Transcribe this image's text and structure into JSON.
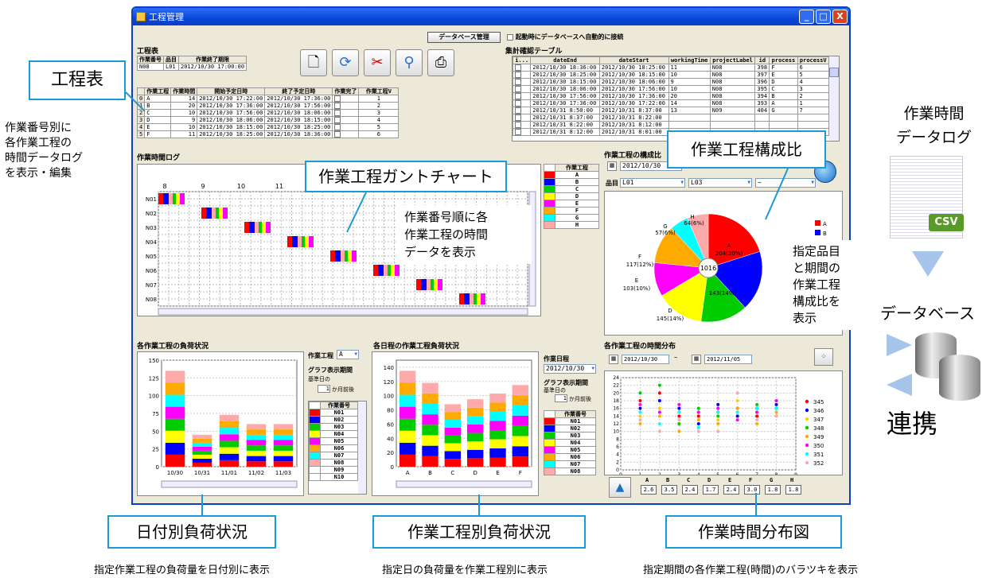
{
  "window": {
    "title": "工程管理",
    "controls": [
      "_",
      "□",
      "X"
    ]
  },
  "top": {
    "db_button": "データベース管理",
    "auto_connect": "起動時にデータベースへ自動的に接続"
  },
  "kouteihyo": {
    "title": "工程表",
    "headers": [
      "作業番号",
      "品目",
      "作業終了期限"
    ],
    "row": [
      "N08",
      "L01",
      "2012/10/30 17:00:00"
    ],
    "detail_headers": [
      "",
      "作業工程",
      "作業時間",
      "開始予定日時",
      "終了予定日時",
      "作業完了",
      "作業工程V"
    ],
    "detail_rows": [
      [
        "0",
        "A",
        "14",
        "2012/10/30 17:22:00",
        "2012/10/30 17:36:00",
        "",
        "1"
      ],
      [
        "1",
        "B",
        "20",
        "2012/10/30 17:36:00",
        "2012/10/30 17:56:00",
        "",
        "2"
      ],
      [
        "2",
        "C",
        "10",
        "2012/10/30 17:56:00",
        "2012/10/30 18:06:00",
        "",
        "3"
      ],
      [
        "3",
        "D",
        "9",
        "2012/10/30 18:06:00",
        "2012/10/30 18:15:00",
        "",
        "4"
      ],
      [
        "4",
        "E",
        "10",
        "2012/10/30 18:15:00",
        "2012/10/30 18:25:00",
        "",
        "5"
      ],
      [
        "5",
        "F",
        "11",
        "2012/10/30 18:25:00",
        "2012/10/30 18:36:00",
        "",
        "6"
      ]
    ]
  },
  "shukei": {
    "title": "集計確認テーブル",
    "headers": [
      "i...",
      "dateEnd",
      "dateStart",
      "workingTime",
      "projectLabel",
      "id",
      "process",
      "processV"
    ],
    "rows": [
      [
        "",
        "2012/10/30 18:36:00",
        "2012/10/30 18:25:00",
        "11",
        "N08",
        "398",
        "F",
        "6"
      ],
      [
        "",
        "2012/10/30 18:25:00",
        "2012/10/30 18:15:00",
        "10",
        "N08",
        "397",
        "E",
        "5"
      ],
      [
        "",
        "2012/10/30 18:15:00",
        "2012/10/30 18:06:00",
        "9",
        "N08",
        "396",
        "D",
        "4"
      ],
      [
        "",
        "2012/10/30 18:06:00",
        "2012/10/30 17:56:00",
        "10",
        "N08",
        "395",
        "C",
        "3"
      ],
      [
        "",
        "2012/10/30 17:56:00",
        "2012/10/30 17:36:00",
        "20",
        "N08",
        "394",
        "B",
        "2"
      ],
      [
        "",
        "2012/10/30 17:36:00",
        "2012/10/30 17:22:00",
        "14",
        "N08",
        "393",
        "A",
        "1"
      ],
      [
        "",
        "2012/10/31 8:50:00",
        "2012/10/31 8:37:00",
        "13",
        "N09",
        "404",
        "G",
        "7"
      ],
      [
        "",
        "2012/10/31 8:37:00",
        "2012/10/31 8:22:00",
        "",
        "",
        "",
        "",
        ""
      ],
      [
        "",
        "2012/10/31 8:22:00",
        "2012/10/31 8:12:00",
        "",
        "",
        "",
        "",
        ""
      ],
      [
        "",
        "2012/10/31 8:12:00",
        "2012/10/31 8:01:00",
        "",
        "",
        "",
        "",
        ""
      ]
    ]
  },
  "gantt": {
    "title": "作業時間ログ",
    "hours": [
      "8",
      "9",
      "10",
      "11",
      "12"
    ],
    "rows": [
      "N01",
      "N02",
      "N03",
      "N04",
      "N05",
      "N06",
      "N07",
      "N08"
    ],
    "legend_title": "作業工程",
    "legend": [
      "A",
      "B",
      "C",
      "D",
      "E",
      "F",
      "G",
      "H"
    ]
  },
  "ratio": {
    "title": "作業工程の構成比",
    "date_from": "2012/10/30",
    "hinmoku_label": "品目",
    "hinmoku_from": "L01",
    "hinmoku_to": "L03",
    "hinmoku_sep": "~",
    "total": "1016",
    "labels": [
      "A",
      "204(20%)",
      "",
      "143(14%)",
      "D",
      "145(14%)",
      "E",
      "103(10%)",
      "F",
      "117(12%)",
      "G",
      "57(6%)",
      "H",
      "64(6%)"
    ],
    "legend": [
      "A",
      "B"
    ]
  },
  "load_date": {
    "title": "各作業工程の負荷状況",
    "process_label": "作業工程",
    "process_value": "A",
    "period_label": "グラフ表示期間",
    "base_label": "基準日の",
    "months": "1",
    "months_suffix": "か月前後",
    "list_title": "作業番号",
    "list": [
      "N01",
      "N02",
      "N03",
      "N04",
      "N05",
      "N06",
      "N07",
      "N08",
      "N09",
      "N10"
    ]
  },
  "load_process": {
    "title": "各日程の作業工程負荷状況",
    "date_label": "作業日程",
    "date_value": "2012/10/30",
    "period_label": "グラフ表示期間",
    "base_label": "基準日の",
    "months": "1",
    "months_suffix": "か月前後",
    "list_title": "作業番号",
    "list": [
      "N01",
      "N02",
      "N03",
      "N04",
      "N05",
      "N06",
      "N07",
      "N08"
    ]
  },
  "dist": {
    "title": "各作業工程の時間分布",
    "date_from": "2012/10/30",
    "tilde": "~",
    "date_to": "2012/11/05",
    "legend": [
      "345",
      "346",
      "347",
      "348",
      "349",
      "350",
      "351",
      "352"
    ],
    "process_labels": [
      "A",
      "B",
      "C",
      "D",
      "E",
      "F",
      "G",
      "H"
    ],
    "process_values": [
      "2.6",
      "3.5",
      "2.4",
      "1.7",
      "2.4",
      "3.0",
      "1.8",
      "1.8"
    ]
  },
  "chart_data": [
    {
      "type": "bar",
      "title": "",
      "categories": [
        "10/30",
        "10/31",
        "11/01",
        "11/02",
        "11/03"
      ],
      "values": [
        135,
        45,
        73,
        60,
        60
      ],
      "ylim": [
        0,
        150
      ],
      "yticks": [
        0,
        25,
        50,
        75,
        100,
        125,
        150
      ]
    },
    {
      "type": "bar",
      "title": "",
      "categories": [
        "A",
        "B",
        "C",
        "D",
        "E",
        "F"
      ],
      "values": [
        135,
        118,
        88,
        95,
        103,
        115
      ],
      "ylim": [
        0,
        150
      ],
      "yticks": [
        0,
        20,
        40,
        60,
        80,
        100,
        120,
        140
      ]
    },
    {
      "type": "pie",
      "title": "",
      "total": 1016,
      "slices": [
        {
          "name": "A",
          "value": 204
        },
        {
          "name": "B",
          "value": 183
        },
        {
          "name": "C",
          "value": 143
        },
        {
          "name": "D",
          "value": 145
        },
        {
          "name": "E",
          "value": 103
        },
        {
          "name": "F",
          "value": 117
        },
        {
          "name": "G",
          "value": 57
        },
        {
          "name": "H",
          "value": 64
        }
      ]
    },
    {
      "type": "scatter",
      "title": "",
      "xlim": [
        0,
        9
      ],
      "ylim": [
        0,
        24
      ],
      "xticks": [
        0,
        1,
        2,
        3,
        4,
        5,
        6,
        7,
        8,
        9
      ],
      "yticks": [
        0,
        2,
        4,
        6,
        8,
        10,
        12,
        14,
        16,
        18,
        20,
        22,
        24
      ],
      "series": [
        {
          "name": "345",
          "x": [
            1,
            2,
            3,
            4,
            5,
            6,
            7,
            8
          ],
          "y": [
            18,
            20,
            14,
            14,
            15,
            16,
            14,
            16
          ]
        },
        {
          "name": "346",
          "x": [
            1,
            2,
            3,
            4,
            5,
            6,
            7,
            8
          ],
          "y": [
            16,
            18,
            16,
            12,
            17,
            14,
            16,
            17
          ]
        },
        {
          "name": "347",
          "x": [
            1,
            2,
            3,
            4,
            5,
            6,
            7,
            8
          ],
          "y": [
            14,
            16,
            12,
            15,
            13,
            18,
            15,
            14
          ]
        },
        {
          "name": "348",
          "x": [
            1,
            2,
            3,
            4,
            5,
            6,
            7,
            8
          ],
          "y": [
            20,
            22,
            12,
            16,
            14,
            15,
            17,
            18
          ]
        },
        {
          "name": "349",
          "x": [
            1,
            2,
            3,
            4,
            5,
            6,
            7,
            8
          ],
          "y": [
            12,
            14,
            10,
            13,
            12,
            16,
            12,
            15
          ]
        },
        {
          "name": "350",
          "x": [
            1,
            2,
            3,
            4,
            5,
            6,
            7,
            8
          ],
          "y": [
            17,
            15,
            17,
            15,
            16,
            13,
            15,
            18
          ]
        },
        {
          "name": "351",
          "x": [
            1,
            2,
            3,
            4,
            5,
            6,
            7,
            8
          ],
          "y": [
            15,
            12,
            15,
            11,
            15,
            15,
            16,
            16
          ]
        },
        {
          "name": "352",
          "x": [
            1,
            2,
            3,
            4,
            5,
            6,
            7,
            8
          ],
          "y": [
            13,
            10,
            13,
            10,
            10,
            20,
            13,
            14
          ]
        }
      ]
    }
  ],
  "colors": {
    "A": "#ff0000",
    "B": "#0000ff",
    "C": "#00cc00",
    "D": "#ffff00",
    "E": "#ff00ff",
    "F": "#ffaa00",
    "G": "#00ffff",
    "H": "#ffaaaa",
    "dark": "#800000",
    "olive": "#999900"
  },
  "annotations": {
    "koutei": "工程表",
    "koutei_note": [
      "作業番号別に",
      "各作業工程の",
      "時間データログ",
      "を表示・編集"
    ],
    "gantt": "作業工程ガントチャート",
    "gantt_note": [
      "作業番号順に各",
      "作業工程の時間",
      "データを表示"
    ],
    "ratio": "作業工程構成比",
    "ratio_note": [
      "指定品目",
      "と期間の",
      "作業工程",
      "構成比を",
      "表示"
    ],
    "date_load": "日付別負荷状況",
    "date_load_note": "指定作業工程の負荷量を日付別に表示",
    "proc_load": "作業工程別負荷状況",
    "proc_load_note": "指定日の負荷量を作業工程別に表示",
    "dist": "作業時間分布図",
    "dist_note": "指定期間の各作業工程(時間)のバラツキを表示",
    "side_log": [
      "作業時間",
      "データログ"
    ],
    "csv": "CSV",
    "db": "データベース",
    "renkei": "連携"
  }
}
